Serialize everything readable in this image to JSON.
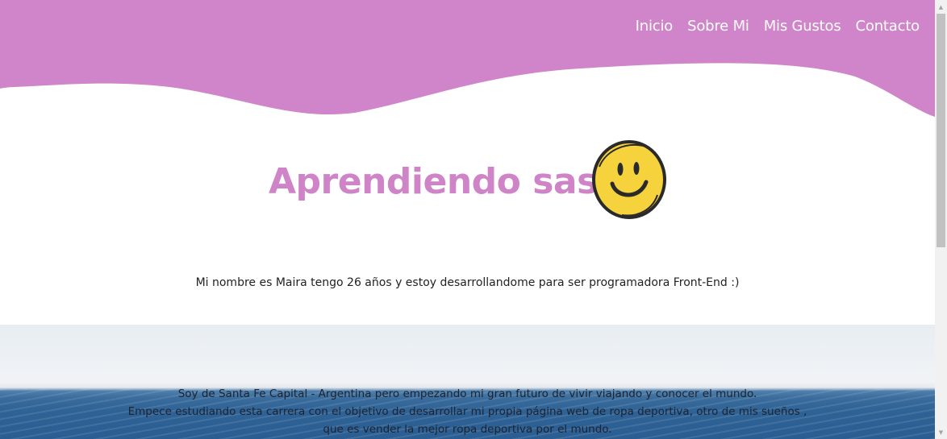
{
  "nav": {
    "items": [
      {
        "label": "Inicio"
      },
      {
        "label": "Sobre Mi"
      },
      {
        "label": "Mis Gustos"
      },
      {
        "label": "Contacto"
      }
    ]
  },
  "hero": {
    "title": "Aprendiendo sass",
    "icon": "smiley-face-icon"
  },
  "intro": {
    "text": "Mi nombre es Maira tengo 26 años y estoy desarrollandome para ser programadora Front-End :)"
  },
  "about": {
    "lines": [
      "Soy de Santa Fe Capital - Argentina pero empezando mi gran futuro de vivir viajando y conocer el mundo.",
      "Empece estudiando esta carrera con el objetivo de desarrollar mi propia página web de ropa deportiva, otro de mis sueños ,",
      "que es vender la mejor ropa deportiva por el mundo."
    ]
  },
  "colors": {
    "accent": "#cf84c8",
    "header": "#d084c9",
    "smiley": "#f6d33c"
  }
}
